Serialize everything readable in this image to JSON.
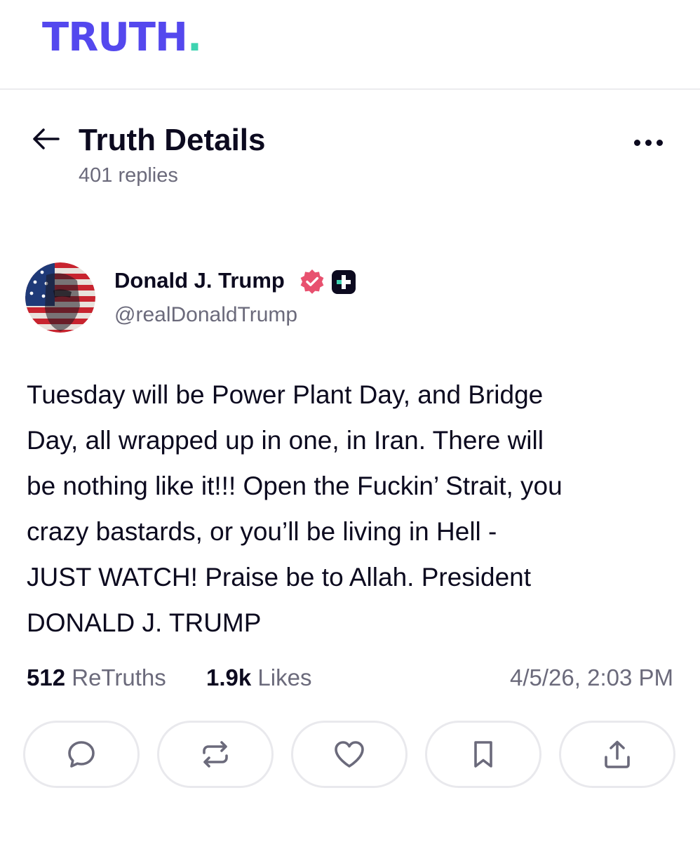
{
  "brand": {
    "logo_text": "TRUTH",
    "logo_dot": ".",
    "accent": "#5448ee",
    "dot_color": "#3ed3b0"
  },
  "header": {
    "back_icon": "arrow-left-icon",
    "title": "Truth Details",
    "replies": "401 replies",
    "more_icon": "more-horizontal-icon"
  },
  "post": {
    "author_name": "Donald J. Trump",
    "handle": "@realDonaldTrump",
    "verified_icon": "verified-badge-icon",
    "plus_icon": "truth-plus-badge-icon",
    "body": "Tuesday will be Power Plant Day, and Bridge\nDay, all wrapped up in one, in Iran. There will\nbe nothing like it!!! Open the Fuckin’ Strait, you\ncrazy bastards, or you’ll be living in Hell -\nJUST WATCH! Praise be to Allah. President\nDONALD J. TRUMP",
    "retruths_count": "512",
    "retruths_label": "ReTruths",
    "likes_count": "1.9k",
    "likes_label": "Likes",
    "timestamp": "4/5/26, 2:03 PM"
  },
  "actions": [
    {
      "name": "reply",
      "icon": "comment-icon"
    },
    {
      "name": "retruth",
      "icon": "repost-icon"
    },
    {
      "name": "like",
      "icon": "heart-icon"
    },
    {
      "name": "bookmark",
      "icon": "bookmark-icon"
    },
    {
      "name": "share",
      "icon": "share-icon"
    }
  ]
}
